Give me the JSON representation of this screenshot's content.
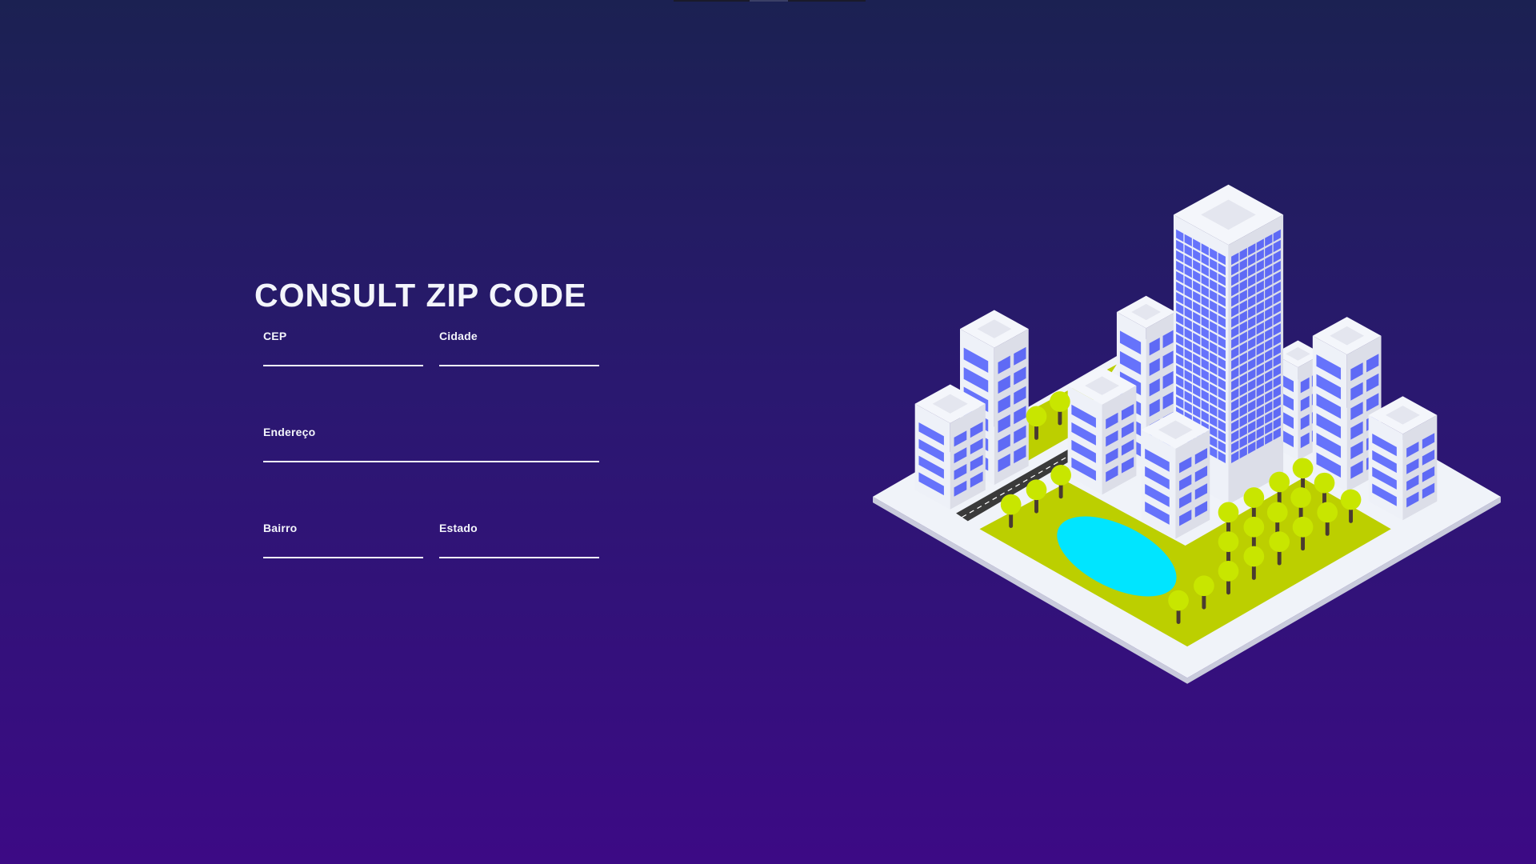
{
  "form": {
    "title": "CONSULT ZIP CODE",
    "fields": {
      "cep": {
        "label": "CEP",
        "value": ""
      },
      "cidade": {
        "label": "Cidade",
        "value": ""
      },
      "endereco": {
        "label": "Endereço",
        "value": ""
      },
      "bairro": {
        "label": "Bairro",
        "value": ""
      },
      "estado": {
        "label": "Estado",
        "value": ""
      }
    }
  },
  "illustration": {
    "subject": "isometric-city",
    "colors": {
      "background_top": "#1b2152",
      "background_bottom": "#3c0a85",
      "window": "#6673fb",
      "building_light": "#eef1f8",
      "building_shade": "#dcdee8",
      "grass": "#bccf00",
      "tree": "#c8e600",
      "trunk": "#4a3b30",
      "pond": "#00e5ff",
      "road": "#3a3a3a"
    }
  }
}
